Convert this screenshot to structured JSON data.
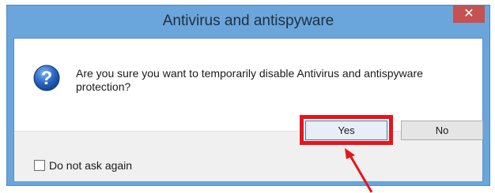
{
  "dialog": {
    "title": "Antivirus and antispyware",
    "close_glyph": "✕",
    "icon": "question-icon",
    "message": "Are you sure you want to temporarily disable Antivirus and antispyware protection?",
    "buttons": {
      "yes": "Yes",
      "no": "No"
    },
    "checkbox": {
      "label": "Do not ask again",
      "checked": false
    }
  },
  "annotation": {
    "highlight_color": "#e8141b",
    "arrow_color": "#e8141b"
  }
}
